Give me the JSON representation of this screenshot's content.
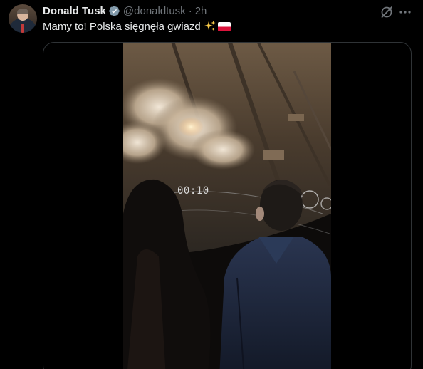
{
  "author": {
    "name": "Donald Tusk",
    "handle": "@donaldtusk",
    "separator": "·",
    "time": "2h",
    "verified_color": "#829aab"
  },
  "tweet": {
    "text": "Mamy to! Polska sięgnęła gwiazd",
    "emoji_1": "sparkles",
    "emoji_2": "flag-poland"
  },
  "media": {
    "type": "video",
    "overlay_timer": "00:10"
  },
  "icons": {
    "grok": "grok-icon",
    "more": "more-icon"
  },
  "colors": {
    "background": "#000000",
    "text": "#e7e9ea",
    "secondary": "#71767b",
    "border": "#2f3336"
  }
}
